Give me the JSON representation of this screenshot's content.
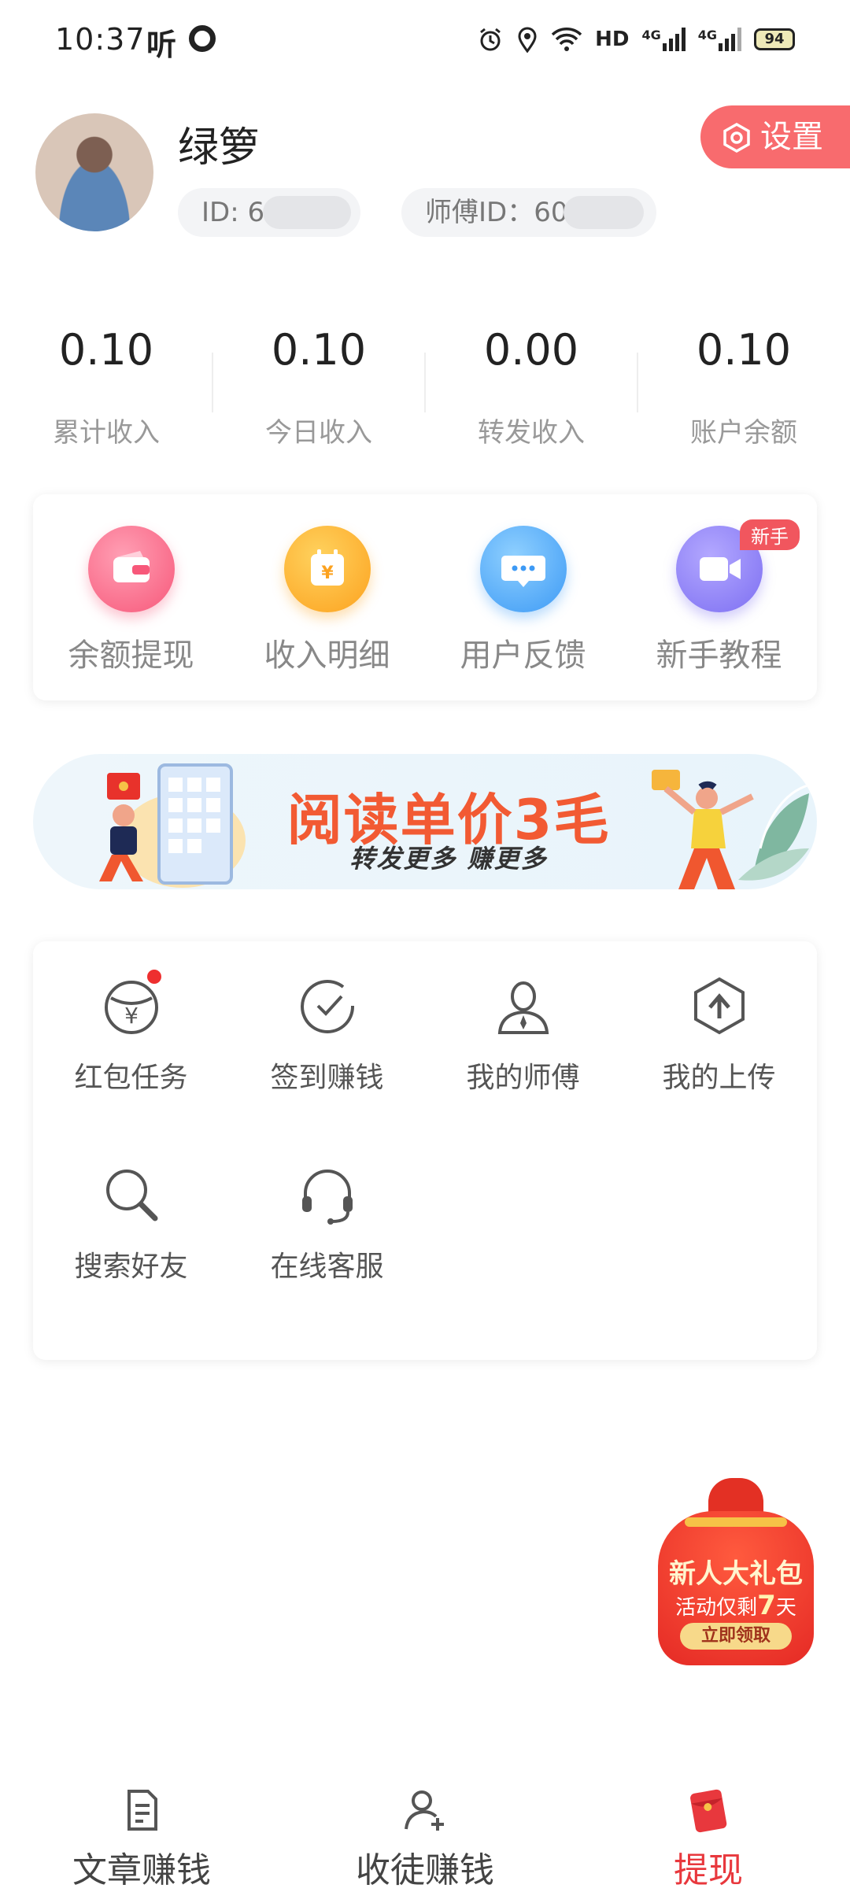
{
  "status": {
    "time": "10:37",
    "ting": "听",
    "hd": "HD",
    "net1": "4G",
    "net2": "4G",
    "battery": "94"
  },
  "profile": {
    "nickname": "绿箩",
    "id_label": "ID: 60",
    "master_label": "师傅ID：60",
    "settings_label": "设置"
  },
  "stats": [
    {
      "value": "0.10",
      "label": "累计收入"
    },
    {
      "value": "0.10",
      "label": "今日收入"
    },
    {
      "value": "0.00",
      "label": "转发收入"
    },
    {
      "value": "0.10",
      "label": "账户余额"
    }
  ],
  "quick": [
    {
      "label": "余额提现",
      "icon": "wallet-icon",
      "color": "#f7587a"
    },
    {
      "label": "收入明细",
      "icon": "calendar-yuan-icon",
      "color": "#fca21f"
    },
    {
      "label": "用户反馈",
      "icon": "chat-bubble-icon",
      "color": "#3d9af5"
    },
    {
      "label": "新手教程",
      "icon": "video-camera-icon",
      "color": "#7d6ff2"
    }
  ],
  "new_badge": "新手",
  "banner": {
    "title": "阅读单价3毛",
    "subtitle": "转发更多 赚更多"
  },
  "grid": [
    {
      "label": "红包任务",
      "icon": "red-envelope-yuan-icon"
    },
    {
      "label": "签到赚钱",
      "icon": "check-clock-icon"
    },
    {
      "label": "我的师傅",
      "icon": "person-icon"
    },
    {
      "label": "我的上传",
      "icon": "upload-hexagon-icon"
    },
    {
      "label": "搜索好友",
      "icon": "search-icon"
    },
    {
      "label": "在线客服",
      "icon": "headset-icon"
    }
  ],
  "gift": {
    "title": "新人大礼包",
    "line_prefix": "活动仅剩",
    "days": "7",
    "line_suffix": "天",
    "button": "立即领取"
  },
  "nav": [
    {
      "label": "文章赚钱",
      "icon": "document-icon"
    },
    {
      "label": "收徒赚钱",
      "icon": "add-person-icon"
    },
    {
      "label": "提现",
      "icon": "red-packet-icon",
      "active": true
    }
  ]
}
